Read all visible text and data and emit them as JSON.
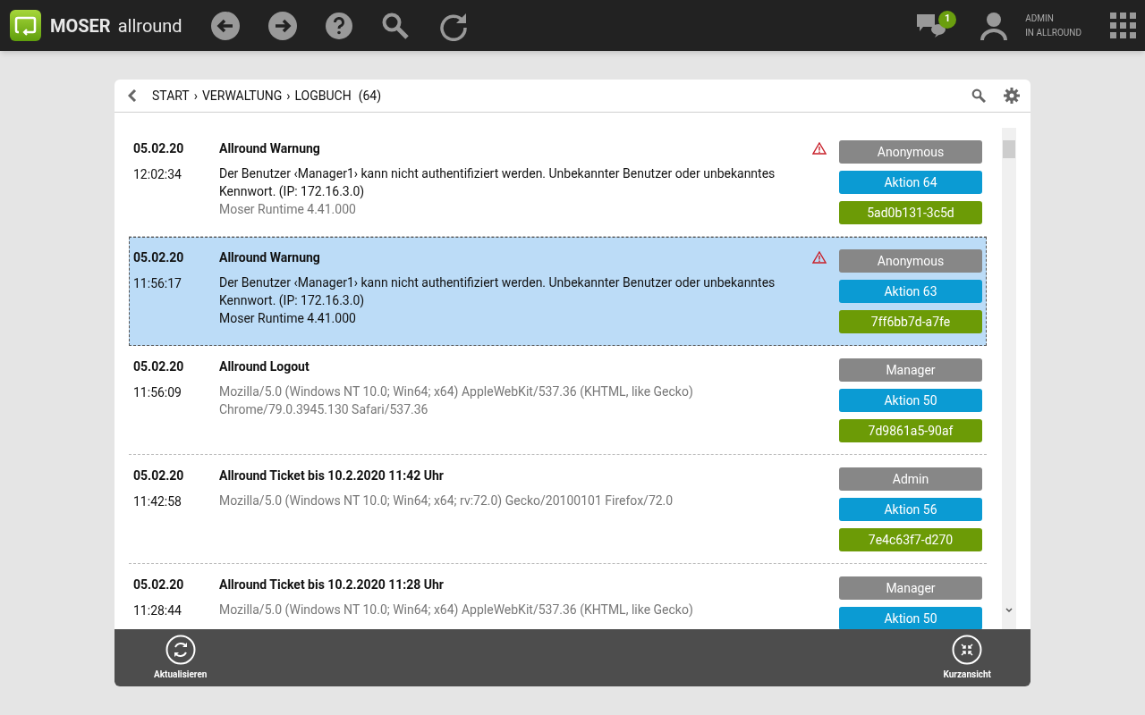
{
  "app": {
    "brand_bold": "MOSER",
    "brand_light": "allround",
    "notification_count": "1",
    "user_line1": "ADMIN",
    "user_line2": "IN ALLROUND"
  },
  "breadcrumb": {
    "items": [
      "START",
      "VERWALTUNG",
      "LOGBUCH"
    ],
    "separator": "›",
    "count": "(64)"
  },
  "log_entries": [
    {
      "date": "05.02.20",
      "time": "12:02:34",
      "title": "Allround Warnung",
      "kind": "warning",
      "selected": false,
      "message": "Der Benutzer ‹Manager1› kann nicht authentifiziert werden. Unbekannter Benutzer oder unbekanntes Kennwort. (IP: 172.16.3.0)",
      "detail": "Moser Runtime 4.41.000",
      "user": "Anonymous",
      "action": "Aktion 64",
      "id": "5ad0b131-3c5d"
    },
    {
      "date": "05.02.20",
      "time": "11:56:17",
      "title": "Allround Warnung",
      "kind": "warning",
      "selected": true,
      "message": "Der Benutzer ‹Manager1› kann nicht authentifiziert werden. Unbekannter Benutzer oder unbekanntes Kennwort. (IP: 172.16.3.0)",
      "detail": "Moser Runtime 4.41.000",
      "user": "Anonymous",
      "action": "Aktion 63",
      "id": "7ff6bb7d-a7fe"
    },
    {
      "date": "05.02.20",
      "time": "11:56:09",
      "title": "Allround Logout",
      "kind": "info",
      "selected": false,
      "message": "Mozilla/5.0 (Windows NT 10.0; Win64; x64) AppleWebKit/537.36 (KHTML, like Gecko) Chrome/79.0.3945.130 Safari/537.36",
      "user": "Manager",
      "action": "Aktion 50",
      "id": "7d9861a5-90af"
    },
    {
      "date": "05.02.20",
      "time": "11:42:58",
      "title": "Allround Ticket bis 10.2.2020 11:42 Uhr",
      "kind": "info",
      "selected": false,
      "message": "Mozilla/5.0 (Windows NT 10.0; Win64; x64; rv:72.0) Gecko/20100101 Firefox/72.0",
      "user": "Admin",
      "action": "Aktion 56",
      "id": "7e4c63f7-d270"
    },
    {
      "date": "05.02.20",
      "time": "11:28:44",
      "title": "Allround Ticket bis 10.2.2020 11:28 Uhr",
      "kind": "info",
      "selected": false,
      "message": "Mozilla/5.0 (Windows NT 10.0; Win64; x64) AppleWebKit/537.36 (KHTML, like Gecko)",
      "user": "Manager",
      "action": "Aktion 50"
    }
  ],
  "footer": {
    "left_label": "Aktualisieren",
    "right_label": "Kurzansicht"
  }
}
